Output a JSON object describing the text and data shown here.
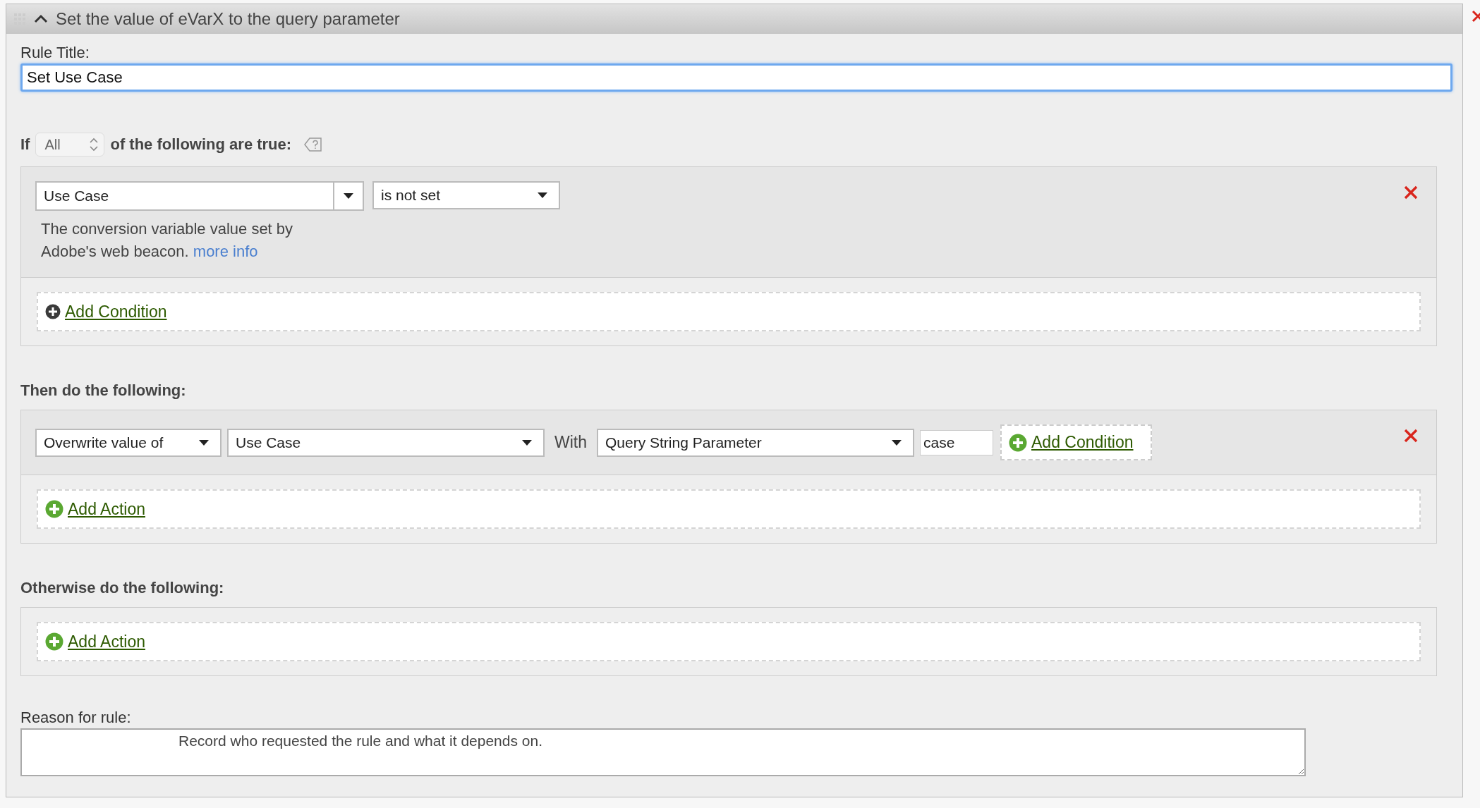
{
  "panel": {
    "title": "Set the value of eVarX to the query parameter",
    "expanded": true
  },
  "rule_title": {
    "label": "Rule Title:",
    "value": "Set Use Case",
    "focused": true
  },
  "conditions": {
    "prefix": "If",
    "match": "All",
    "suffix": "of the following are true:",
    "items": [
      {
        "variable": "Use Case",
        "operator": "is not set",
        "description": "The conversion variable value set by Adobe's web beacon.",
        "link": "more info"
      }
    ],
    "add_label": "Add Condition"
  },
  "then": {
    "heading": "Then do the following:",
    "actions": [
      {
        "verb": "Overwrite value of",
        "variable": "Use Case",
        "with_label": "With",
        "source": "Query String Parameter",
        "parameter": "case",
        "add_condition_label": "Add Condition"
      }
    ],
    "add_label": "Add Action"
  },
  "otherwise": {
    "heading": "Otherwise do the following:",
    "add_label": "Add Action"
  },
  "reason": {
    "label": "Reason for rule:",
    "value": "Record who requested the rule and what it depends on."
  }
}
